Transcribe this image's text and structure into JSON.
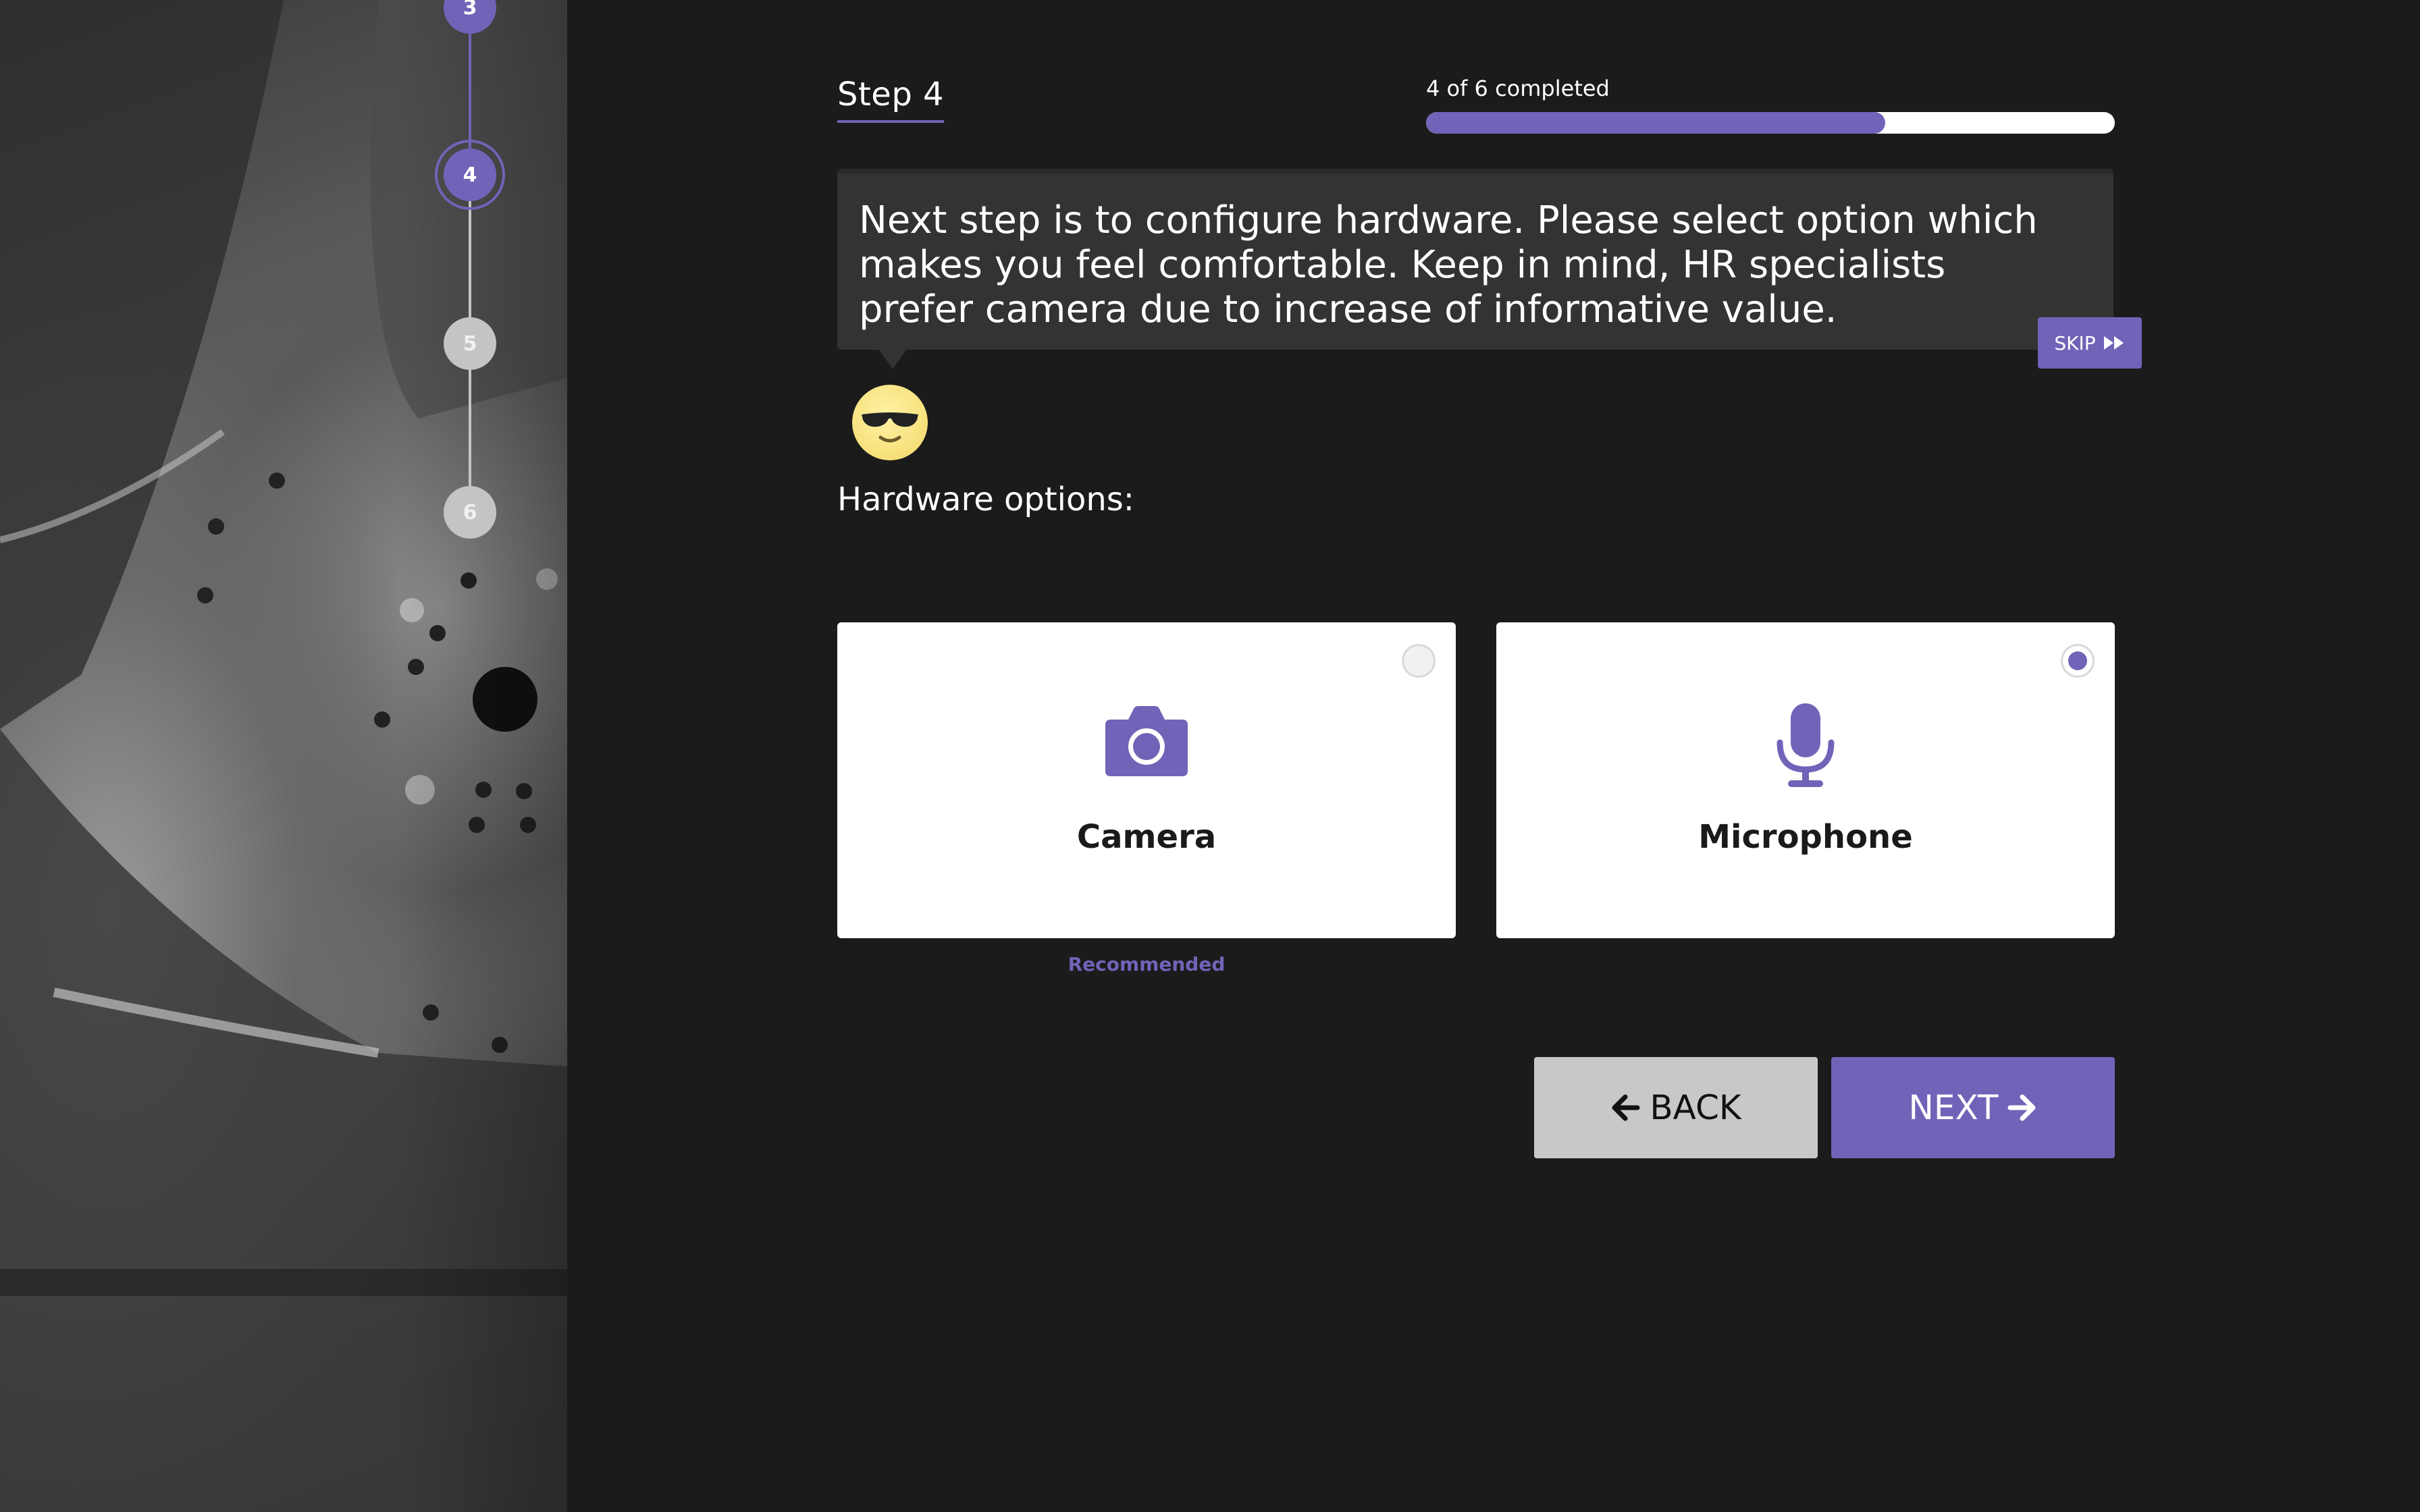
{
  "stepper": {
    "steps": [
      {
        "number": "3",
        "state": "done"
      },
      {
        "number": "4",
        "state": "current"
      },
      {
        "number": "5",
        "state": "todo"
      },
      {
        "number": "6",
        "state": "todo"
      }
    ]
  },
  "header": {
    "step_title": "Step 4",
    "progress_label": "4 of 6 completed",
    "progress_fraction": 0.6667
  },
  "message": {
    "text": "Next step is to configure hardware. Please select option which makes you feel comfortable. Keep in mind, HR specialists prefer camera due to increase of informative value.",
    "skip_label": "SKIP"
  },
  "hardware": {
    "section_label": "Hardware options:",
    "options": [
      {
        "label": "Camera",
        "icon": "camera-icon",
        "selected": false,
        "note": "Recommended"
      },
      {
        "label": "Microphone",
        "icon": "microphone-icon",
        "selected": true
      }
    ]
  },
  "nav": {
    "back_label": "BACK",
    "next_label": "NEXT"
  },
  "colors": {
    "accent": "#7163b8",
    "background": "#1b1b1b",
    "bubble": "#333334"
  }
}
